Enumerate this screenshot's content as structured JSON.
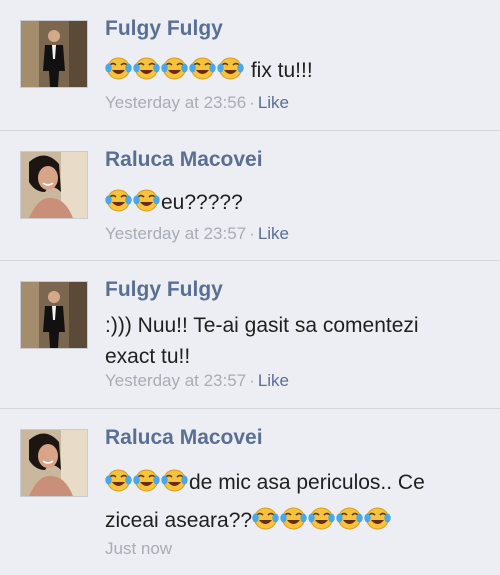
{
  "comments": [
    {
      "author": "Fulgy Fulgy",
      "avatar_icon": "man-in-suit-photo",
      "text_after_emoji": " fix tu!!!",
      "timestamp": "Yesterday at 23:56",
      "like_label": "Like"
    },
    {
      "author": "Raluca Macovei",
      "avatar_icon": "woman-portrait-photo",
      "text_after_emoji": "eu?????",
      "timestamp": "Yesterday at 23:57",
      "like_label": "Like"
    },
    {
      "author": "Fulgy Fulgy",
      "avatar_icon": "man-in-suit-photo",
      "line1": ":))) Nuu!! Te-ai gasit sa comentezi",
      "line2": "exact tu!!",
      "timestamp": "Yesterday at 23:57",
      "like_label": "Like"
    },
    {
      "author": "Raluca Macovei",
      "avatar_icon": "woman-portrait-photo",
      "line1_text": "de mic asa periculos.. Ce",
      "line2_text": "ziceai aseara??",
      "timestamp": "Just now"
    }
  ],
  "emoji_icon": "tears-of-joy-emoji",
  "colors": {
    "background": "#eceef3",
    "author": "#5a6f94",
    "meta": "#a8acb5",
    "text": "#1f1f1f"
  }
}
